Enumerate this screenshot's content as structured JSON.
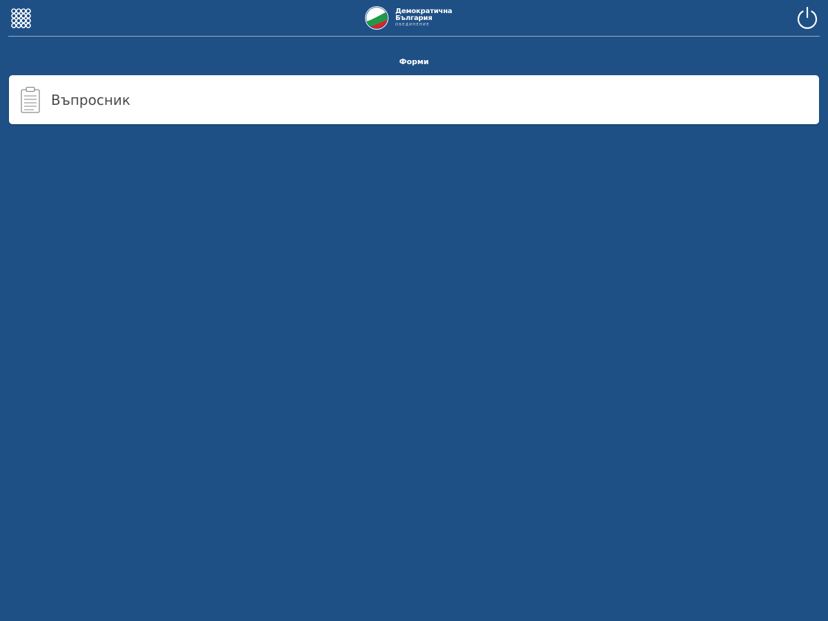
{
  "header": {
    "logo": {
      "line1": "Демократична",
      "line2": "България",
      "line3": "ОБЕДИНЕНИЕ"
    },
    "menu_icon": "grid-menu-icon",
    "power_icon": "power-icon"
  },
  "main": {
    "section_title": "Форми",
    "forms": [
      {
        "label": "Въпросник",
        "icon": "clipboard-icon"
      }
    ]
  },
  "colors": {
    "background": "#1e5086",
    "card": "#ffffff",
    "card_text": "#4a4a4a",
    "flag_white": "#ffffff",
    "flag_green": "#1f9a48",
    "flag_red": "#d8232a"
  }
}
